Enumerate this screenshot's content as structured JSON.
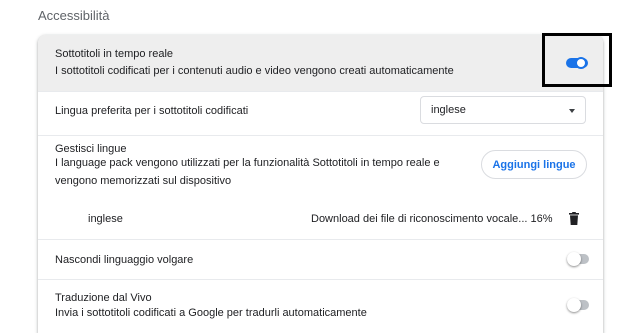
{
  "section": {
    "title": "Accessibilità"
  },
  "live_caption": {
    "title": "Sottotitoli in tempo reale",
    "description": "I sottotitoli codificati per i contenuti audio e video vengono creati automaticamente",
    "enabled": true
  },
  "preferred_language": {
    "label": "Lingua preferita per i sottotitoli codificati",
    "selected": "inglese"
  },
  "manage_languages": {
    "title": "Gestisci lingue",
    "description_line1": "I language pack vengono utilizzati per la funzionalità Sottotitoli in tempo reale e",
    "description_line2": "vengono memorizzati sul dispositivo",
    "add_button": "Aggiungi lingue"
  },
  "language_item": {
    "name": "inglese",
    "status": "Download dei file di riconoscimento vocale... 16%",
    "icon": "trash-icon"
  },
  "mask_profanity": {
    "label": "Nascondi linguaggio volgare",
    "enabled": false
  },
  "live_translate": {
    "title": "Traduzione dal Vivo",
    "description": "Invia i sottotitoli codificati a Google per tradurli automaticamente",
    "enabled": false
  },
  "colors": {
    "accent": "#1a73e8",
    "highlight_row": "#eeeeee",
    "toggle_off": "#bdc1c6"
  }
}
